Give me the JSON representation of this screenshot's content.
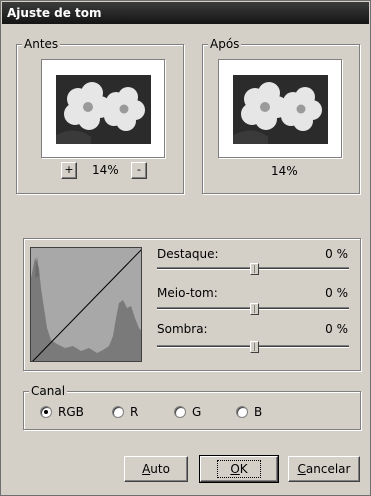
{
  "window": {
    "title": "Ajuste de tom"
  },
  "before": {
    "label": "Antes",
    "zoom": "14%",
    "zoom_in": "+",
    "zoom_out": "-"
  },
  "after": {
    "label": "Após",
    "zoom": "14%"
  },
  "sliders": [
    {
      "label": "Destaque:",
      "value": "0 %"
    },
    {
      "label": "Meio-tom:",
      "value": "0 %"
    },
    {
      "label": "Sombra:",
      "value": "0 %"
    }
  ],
  "channel": {
    "label": "Canal",
    "options": [
      "RGB",
      "R",
      "G",
      "B"
    ],
    "selected": "RGB"
  },
  "buttons": {
    "auto_prefix": "",
    "auto_accel": "A",
    "auto_rest": "uto",
    "ok_accel": "O",
    "ok_rest": "K",
    "cancel_accel": "C",
    "cancel_rest": "ancelar"
  }
}
